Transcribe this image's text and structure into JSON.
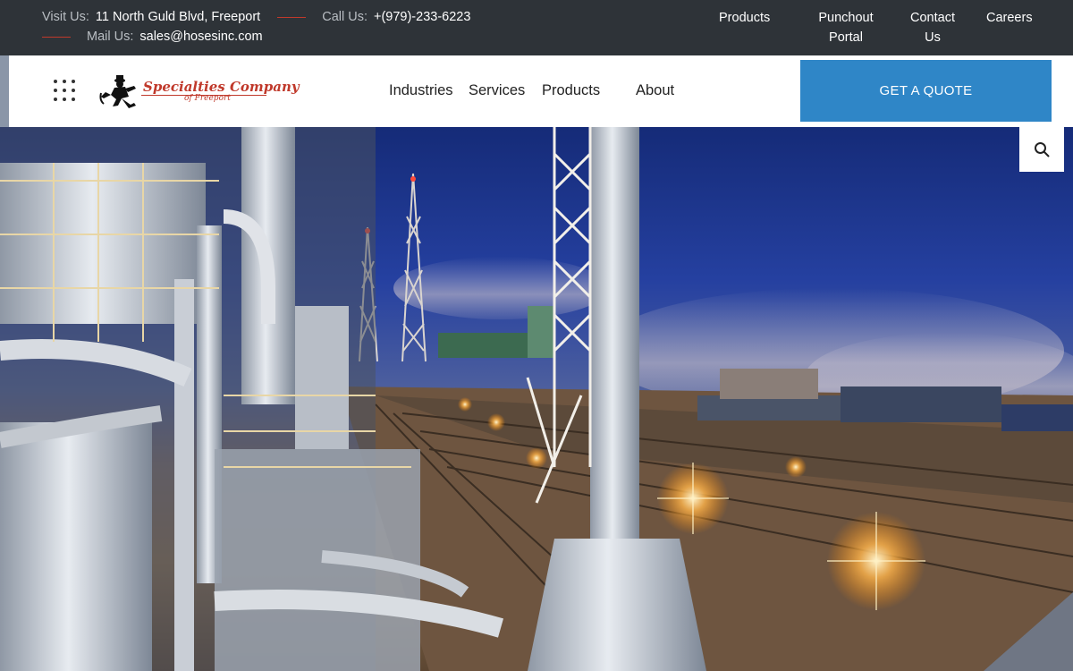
{
  "topbar": {
    "visit_label": "Visit Us:",
    "visit_value": "11 North Guld Blvd, Freeport",
    "call_label": "Call Us:",
    "call_value": "+(979)-233-6223",
    "mail_label": "Mail Us:",
    "mail_value": "sales@hosesinc.com",
    "links": {
      "products": "Products",
      "punchout_line1": "Punchout",
      "punchout_line2": "Portal",
      "contact_line1": "Contact",
      "contact_line2": "Us",
      "careers": "Careers"
    },
    "accent_color": "#c0392b",
    "background_color": "#2e3338"
  },
  "nav": {
    "logo_text": "Specialties Company",
    "logo_subtext": "of Freeport",
    "menu": {
      "industries": "Industries",
      "services": "Services",
      "products": "Products",
      "about": "About"
    },
    "quote_button": "GET A QUOTE",
    "quote_button_color": "#2f86c7",
    "grid_icon": "apps-grid-icon",
    "search_icon": "search-icon"
  },
  "hero": {
    "image_description_icon": "industrial-refinery-photo"
  }
}
